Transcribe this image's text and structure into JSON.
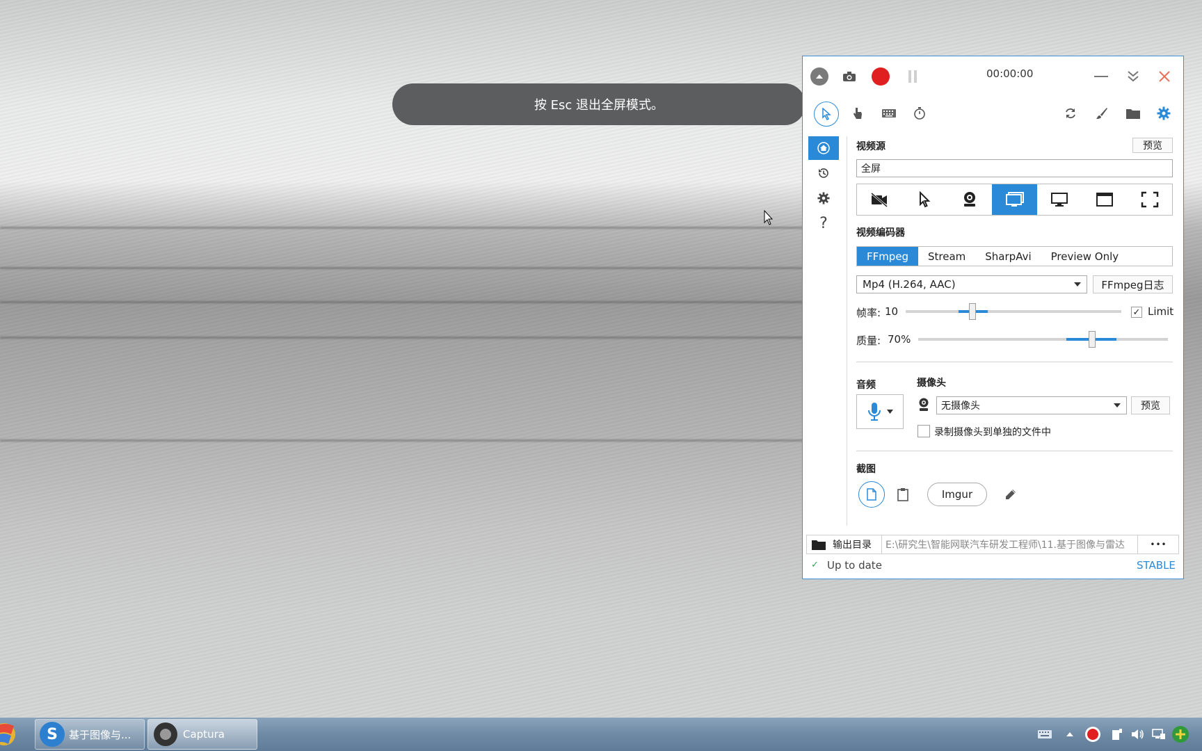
{
  "fullscreen_hint": "按 Esc 退出全屏模式。",
  "toolbar": {
    "timer": "00:00:00"
  },
  "video_source": {
    "heading": "视频源",
    "preview_label": "预览",
    "current": "全屏",
    "options": [
      "no-video",
      "region",
      "webcam",
      "screen",
      "window",
      "region",
      "fullscreen"
    ],
    "selected_index": 3
  },
  "encoder": {
    "heading": "视频编码器",
    "tabs": [
      "FFmpeg",
      "Stream",
      "SharpAvi",
      "Preview Only"
    ],
    "active_tab": 0,
    "format": "Mp4 (H.264, AAC)",
    "log_button": "FFmpeg日志",
    "framerate_label": "帧率:",
    "framerate_value": "10",
    "limit_label": "Limit",
    "limit_checked": true,
    "quality_label": "质量:",
    "quality_value": "70%"
  },
  "audio": {
    "heading": "音频"
  },
  "webcam": {
    "heading": "摄像头",
    "selected": "无摄像头",
    "preview_label": "预览",
    "separate_file_label": "录制摄像头到单独的文件中"
  },
  "screenshot": {
    "heading": "截图",
    "imgur_label": "Imgur"
  },
  "output": {
    "label": "输出目录",
    "path": "E:\\研究生\\智能网联汽车研发工程师\\11.基于图像与雷达",
    "more": "•••"
  },
  "status": {
    "text": "Up to date",
    "channel": "STABLE"
  },
  "taskbar": {
    "items": [
      {
        "label": "基于图像与..."
      },
      {
        "label": "Captura"
      }
    ]
  },
  "colors": {
    "accent": "#2a8ad8",
    "record": "#e02020",
    "close": "#e8705a"
  }
}
